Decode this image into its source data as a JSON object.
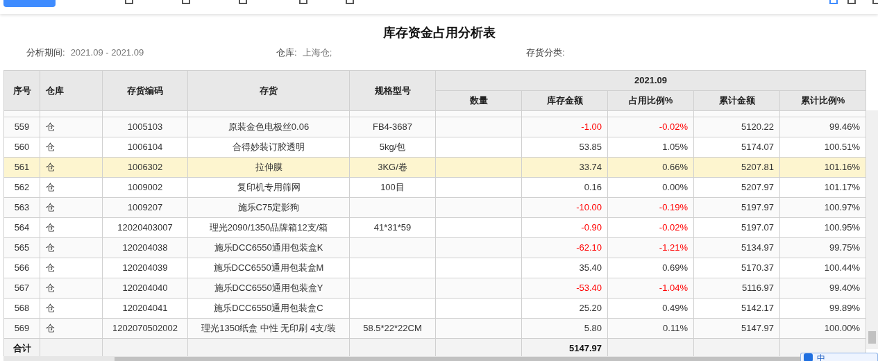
{
  "report": {
    "title": "库存资金占用分析表",
    "filters": [
      {
        "label": "分析期间:",
        "value": "2021.09 - 2021.09"
      },
      {
        "label": "仓库:",
        "value": "上海仓;"
      },
      {
        "label": "存货分类:"
      }
    ]
  },
  "table": {
    "columns": [
      "序号",
      "仓库",
      "存货编码",
      "存货",
      "规格型号"
    ],
    "period": "2021.09",
    "sub_columns": [
      "数量",
      "库存金额",
      "占用比例%",
      "累计金额",
      "累计比例%"
    ],
    "rows": [
      {
        "no": "559",
        "warehouse": "仓",
        "code": "1005103",
        "name": "原装金色电极丝0.06",
        "spec": "FB4-3687",
        "amount": "-1.00",
        "ratio": "-0.02%",
        "cum_amount": "5120.22",
        "cum_ratio": "99.46%",
        "negative": true,
        "selected": false
      },
      {
        "no": "560",
        "warehouse": "仓",
        "code": "1006104",
        "name": "合得妙装订胶透明",
        "spec": "5kg/包",
        "amount": "53.85",
        "ratio": "1.05%",
        "cum_amount": "5174.07",
        "cum_ratio": "100.51%",
        "negative": false,
        "selected": false
      },
      {
        "no": "561",
        "warehouse": "仓",
        "code": "1006302",
        "name": "拉伸膜",
        "spec": "3KG/卷",
        "amount": "33.74",
        "ratio": "0.66%",
        "cum_amount": "5207.81",
        "cum_ratio": "101.16%",
        "negative": false,
        "selected": true
      },
      {
        "no": "562",
        "warehouse": "仓",
        "code": "1009002",
        "name": "复印机专用筛网",
        "spec": "100目",
        "amount": "0.16",
        "ratio": "0.00%",
        "cum_amount": "5207.97",
        "cum_ratio": "101.17%",
        "negative": false,
        "selected": false
      },
      {
        "no": "563",
        "warehouse": "仓",
        "code": "1009207",
        "name": "施乐C75定影狗",
        "amount": "-10.00",
        "ratio": "-0.19%",
        "cum_amount": "5197.97",
        "cum_ratio": "100.97%",
        "negative": true,
        "selected": false
      },
      {
        "no": "564",
        "warehouse": "仓",
        "code": "12020403007",
        "name": "理光2090/1350品牌箱12支/箱",
        "spec": "41*31*59",
        "amount": "-0.90",
        "ratio": "-0.02%",
        "cum_amount": "5197.07",
        "cum_ratio": "100.95%",
        "negative": true,
        "selected": false
      },
      {
        "no": "565",
        "warehouse": "仓",
        "code": "120204038",
        "name": "施乐DCC6550通用包装盒K",
        "amount": "-62.10",
        "ratio": "-1.21%",
        "cum_amount": "5134.97",
        "cum_ratio": "99.75%",
        "negative": true,
        "selected": false
      },
      {
        "no": "566",
        "warehouse": "仓",
        "code": "120204039",
        "name": "施乐DCC6550通用包装盒M",
        "amount": "35.40",
        "ratio": "0.69%",
        "cum_amount": "5170.37",
        "cum_ratio": "100.44%",
        "negative": false,
        "selected": false
      },
      {
        "no": "567",
        "warehouse": "仓",
        "code": "120204040",
        "name": "施乐DCC6550通用包装盒Y",
        "amount": "-53.40",
        "ratio": "-1.04%",
        "cum_amount": "5116.97",
        "cum_ratio": "99.40%",
        "negative": true,
        "selected": false
      },
      {
        "no": "568",
        "warehouse": "仓",
        "code": "120204041",
        "name": "施乐DCC6550通用包装盒C",
        "amount": "25.20",
        "ratio": "0.49%",
        "cum_amount": "5142.17",
        "cum_ratio": "99.89%",
        "negative": false,
        "selected": false
      },
      {
        "no": "569",
        "warehouse": "仓",
        "code": "1202070502002",
        "name": "理光1350纸盒 中性 无印刷 4支/装",
        "spec": "58.5*22*22CM",
        "amount": "5.80",
        "ratio": "0.11%",
        "cum_amount": "5147.97",
        "cum_ratio": "100.00%",
        "negative": false,
        "selected": false
      }
    ],
    "total": {
      "label": "合计",
      "amount": "5147.97"
    }
  },
  "ime_bar": {
    "label": "中"
  }
}
